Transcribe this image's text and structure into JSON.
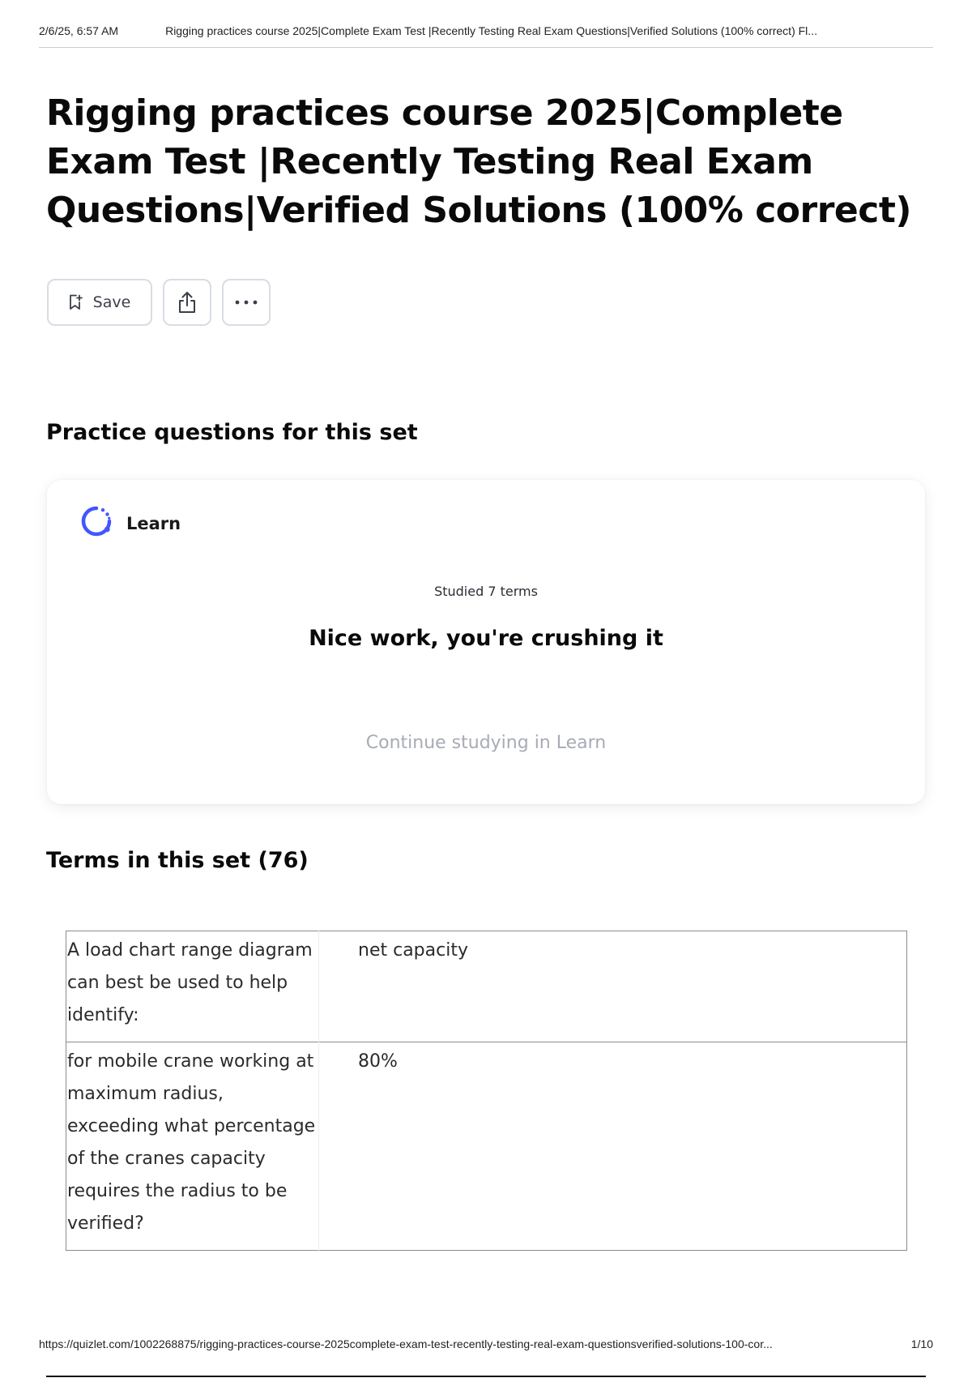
{
  "print_header": {
    "date": "2/6/25, 6:57 AM",
    "doc_title": "Rigging practices course 2025|Complete Exam Test |Recently Testing Real Exam Questions|Verified Solutions (100% correct) Fl..."
  },
  "title": "Rigging practices course 2025|Complete Exam Test |Recently Testing Real Exam Questions|Verified Solutions (100% correct)",
  "toolbar": {
    "save_label": "Save",
    "save_icon": "bookmark-add-icon",
    "share_icon": "share-icon",
    "more_icon": "more-horizontal-icon"
  },
  "practice": {
    "heading": "Practice questions for this set",
    "learn_label": "Learn",
    "learn_icon": "learn-progress-icon",
    "studied": "Studied 7 terms",
    "praise": "Nice work, you're crushing it",
    "continue_label": "Continue studying in Learn"
  },
  "terms": {
    "heading": "Terms in this set (76)",
    "rows": [
      {
        "term": "A load chart range diagram can best be used to help identify:",
        "definition": "net capacity"
      },
      {
        "term": "for mobile crane working at maximum radius, exceeding what percentage of the cranes capacity requires the radius to be verified?",
        "definition": "80%"
      }
    ]
  },
  "print_footer": {
    "url": "https://quizlet.com/1002268875/rigging-practices-course-2025complete-exam-test-recently-testing-real-exam-questionsverified-solutions-100-cor...",
    "page": "1/10"
  },
  "colors": {
    "learn_icon": "#4255ff",
    "continue_text": "#a8abb5",
    "button_border": "#d9dce3"
  }
}
